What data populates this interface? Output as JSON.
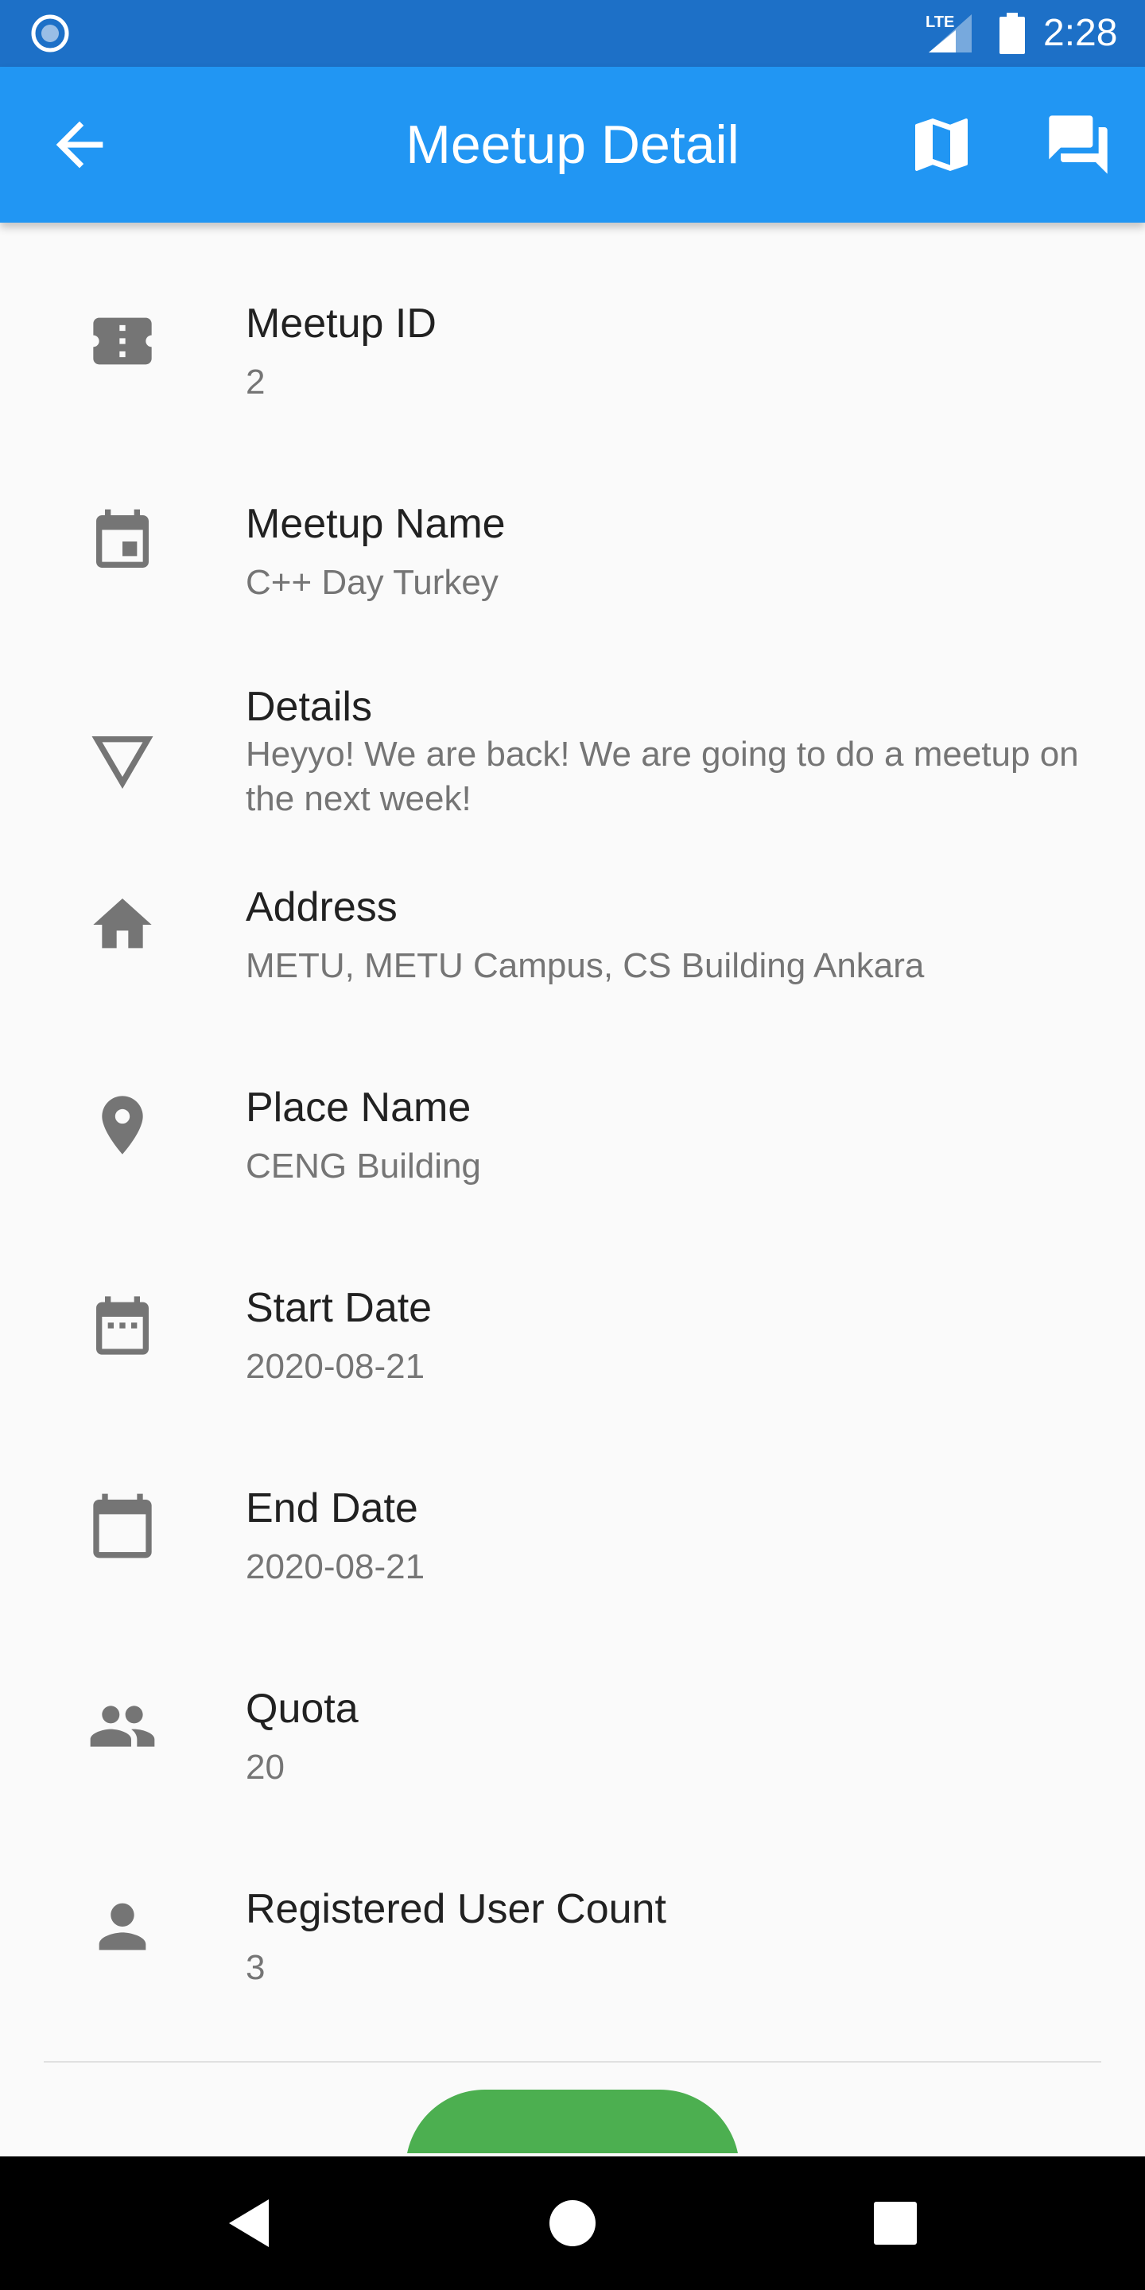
{
  "status_bar": {
    "time": "2:28",
    "network_label": "LTE",
    "icons": [
      "record-icon",
      "lte-signal-icon",
      "battery-icon"
    ]
  },
  "app_bar": {
    "title": "Meetup Detail",
    "color": "#2196f3",
    "icons": [
      "arrow-back-icon",
      "map-icon",
      "forum-icon"
    ]
  },
  "details": [
    {
      "title": "Meetup ID",
      "value": "2",
      "icon": "ticket-icon"
    },
    {
      "title": "Meetup Name",
      "value": "C++ Day Turkey",
      "icon": "event-icon"
    },
    {
      "title": "Details",
      "value": "Heyyo! We are back! We are going to do a meetup on the next week!",
      "icon": "triangle-down-icon"
    },
    {
      "title": "Address",
      "value": "METU, METU Campus, CS Building Ankara",
      "icon": "home-icon"
    },
    {
      "title": "Place Name",
      "value": "CENG Building",
      "icon": "place-icon"
    },
    {
      "title": "Start Date",
      "value": "2020-08-21",
      "icon": "calendar-dots-icon"
    },
    {
      "title": "End Date",
      "value": "2020-08-21",
      "icon": "calendar-icon"
    },
    {
      "title": "Quota",
      "value": "20",
      "icon": "people-icon"
    },
    {
      "title": "Registered User Count",
      "value": "3",
      "icon": "person-icon"
    }
  ],
  "join_button": {
    "color": "#4caf50"
  },
  "nav_bar": {
    "icons": [
      "nav-back-icon",
      "nav-home-icon",
      "nav-recents-icon"
    ]
  }
}
